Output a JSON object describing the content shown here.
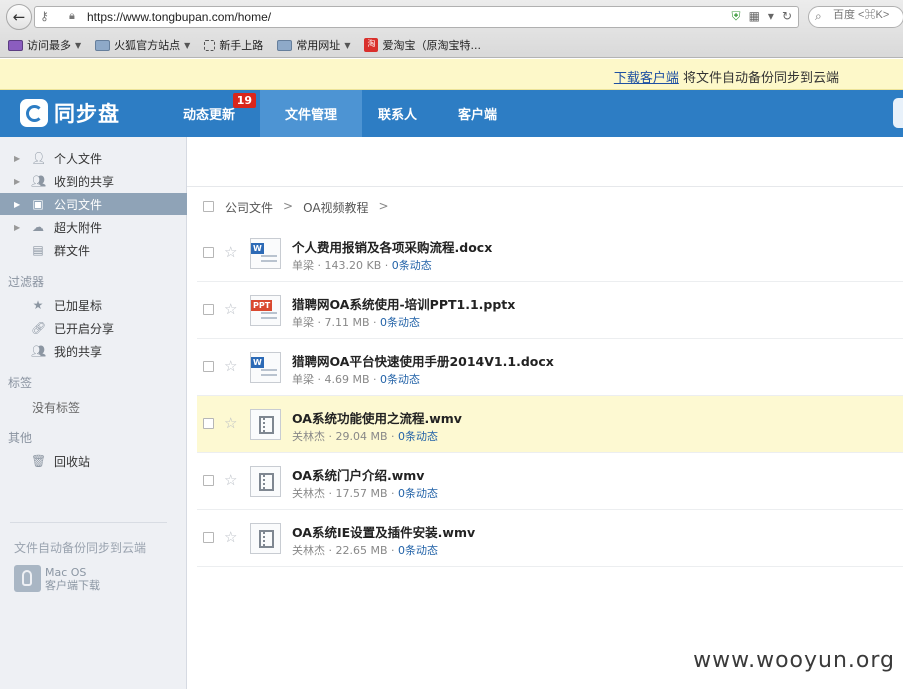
{
  "browser": {
    "back_glyph": "←",
    "url": "https://www.tongbupan.com/home/",
    "search_placeholder": "百度 <⌘K>",
    "bookmarks": [
      {
        "label": "访问最多",
        "icon": "purple-icon",
        "dropdown": true
      },
      {
        "label": "火狐官方站点",
        "icon": "folder-icon",
        "dropdown": true
      },
      {
        "label": "新手上路",
        "icon": "dashed-page-icon",
        "dropdown": false
      },
      {
        "label": "常用网址",
        "icon": "folder-icon",
        "dropdown": true
      },
      {
        "label": "爱淘宝（原淘宝特...",
        "icon": "taobao-icon",
        "dropdown": false
      }
    ]
  },
  "banner": {
    "link": "下载客户端",
    "text": " 将文件自动备份同步到云端"
  },
  "header": {
    "logo": "同步盘",
    "nav": [
      {
        "label": "动态更新",
        "badge": "19"
      },
      {
        "label": "文件管理",
        "active": true
      },
      {
        "label": "联系人"
      },
      {
        "label": "客户端"
      }
    ]
  },
  "sidebar": {
    "folders": [
      {
        "label": "个人文件",
        "icon": "person-icon"
      },
      {
        "label": "收到的共享",
        "icon": "people-icon"
      },
      {
        "label": "公司文件",
        "icon": "inbox-icon",
        "selected": true
      },
      {
        "label": "超大附件",
        "icon": "cloud-icon"
      },
      {
        "label": "群文件",
        "icon": "group-file-icon"
      }
    ],
    "filter_title": "过滤器",
    "filters": [
      {
        "label": "已加星标",
        "icon": "star-icon"
      },
      {
        "label": "已开启分享",
        "icon": "link-icon"
      },
      {
        "label": "我的共享",
        "icon": "people-icon"
      }
    ],
    "tags_title": "标签",
    "no_tags": "没有标签",
    "other_title": "其他",
    "trash": {
      "label": "回收站",
      "icon": "trash-icon"
    },
    "promo": "文件自动备份同步到云端",
    "mac_title": "Mac OS",
    "mac_sub": "客户端下载"
  },
  "breadcrumb": [
    "公司文件",
    ">",
    "OA视频教程",
    ">"
  ],
  "files": [
    {
      "name": "个人费用报销及各项采购流程.docx",
      "owner": "单梁",
      "size": "143.20 KB",
      "activity": "0条动态",
      "type": "word"
    },
    {
      "name": "猎聘网OA系统使用-培训PPT1.1.pptx",
      "owner": "单梁",
      "size": "7.11 MB",
      "activity": "0条动态",
      "type": "ppt"
    },
    {
      "name": "猎聘网OA平台快速使用手册2014V1.1.docx",
      "owner": "单梁",
      "size": "4.69 MB",
      "activity": "0条动态",
      "type": "word"
    },
    {
      "name": "OA系统功能使用之流程.wmv",
      "owner": "关林杰",
      "size": "29.04 MB",
      "activity": "0条动态",
      "type": "video",
      "highlight": true
    },
    {
      "name": "OA系统门户介绍.wmv",
      "owner": "关林杰",
      "size": "17.57 MB",
      "activity": "0条动态",
      "type": "video"
    },
    {
      "name": "OA系统IE设置及插件安装.wmv",
      "owner": "关林杰",
      "size": "22.65 MB",
      "activity": "0条动态",
      "type": "video"
    }
  ],
  "labels": {
    "word_tag": "W",
    "ppt_tag": "PPT",
    "meta_sep": " · "
  },
  "watermark": "www.wooyun.org",
  "colors": {
    "header_blue": "#2d7dc4",
    "active_tab": "#4d94d3",
    "badge_red": "#d9261c",
    "banner_yellow": "#fdf8c9",
    "highlight_row": "#fdf9d2",
    "link_blue": "#2363a8"
  }
}
